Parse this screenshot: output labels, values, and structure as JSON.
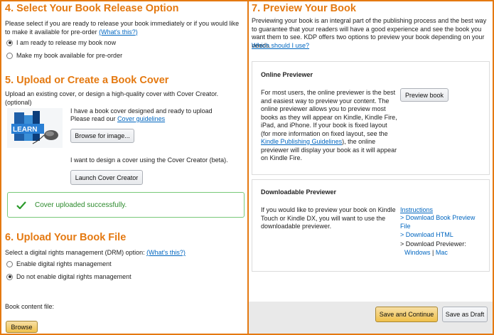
{
  "section4": {
    "title": "4. Select Your Book Release Option",
    "description": "Please select if you are ready to release your book immediately or if you would like to make it available for pre-order",
    "whats_this": "(What's this?)",
    "options": [
      {
        "label": "I am ready to release my book now",
        "checked": true
      },
      {
        "label": "Make my book available for pre-order",
        "checked": false
      }
    ]
  },
  "section5": {
    "title": "5. Upload or Create a Book Cover",
    "description": "Upload an existing cover, or design a high-quality cover with Cover Creator. (optional)",
    "have_cover": "I have a book cover designed and ready to upload",
    "read_our": "Please read our",
    "cover_guidelines": "Cover guidelines",
    "browse_image_button": "Browse for image...",
    "design_cover": "I want to design a cover using the Cover Creator (beta).",
    "launch_button": "Launch Cover Creator",
    "thumbnail_text": "LEARN",
    "success_message": "Cover uploaded successfully."
  },
  "section6": {
    "title": "6. Upload Your Book File",
    "drm_prompt": "Select a digital rights management (DRM) option:",
    "whats_this": "(What's this?)",
    "options": [
      {
        "label": "Enable digital rights management",
        "checked": false
      },
      {
        "label": "Do not enable digital rights management",
        "checked": true
      }
    ],
    "content_file_label": "Book content file:",
    "browse_button": "Browse"
  },
  "section7": {
    "title": "7. Preview Your Book",
    "intro": "Previewing your book is an integral part of the publishing process and the best way to guarantee that your readers will have a good experience and see the book you want them to see. KDP offers two options to preview your book depending on your needs.",
    "which_link": "Which should I use?",
    "online": {
      "title": "Online Previewer",
      "text_before": "For most users, the online previewer is the best and easiest way to preview your content. The online previewer allows you to preview most books as they will appear on Kindle, Kindle Fire, iPad, and iPhone. If your book is fixed layout (for more information on fixed layout, see the",
      "guidelines_link": "Kindle Publishing Guidelines",
      "text_after": "), the online previewer will display your book as it will appear on Kindle Fire.",
      "button": "Preview book"
    },
    "downloadable": {
      "title": "Downloadable Previewer",
      "text": "If you would like to preview your book on Kindle Touch or Kindle DX, you will want to use the downloadable previewer.",
      "instructions": "Instructions",
      "links": [
        {
          "prefix": "> ",
          "label": "Download Book Preview File"
        },
        {
          "prefix": "> ",
          "label": "Download HTML"
        }
      ],
      "download_previewer": "> Download Previewer:",
      "windows": "Windows",
      "separator": "|",
      "mac": "Mac"
    },
    "save_continue_button": "Save and Continue",
    "save_draft_button": "Save as Draft"
  },
  "colors": {
    "accent": "#e47911",
    "link": "#0066c0",
    "success": "#2b8a2b"
  },
  "icons": {
    "success": "checkmark-icon"
  }
}
